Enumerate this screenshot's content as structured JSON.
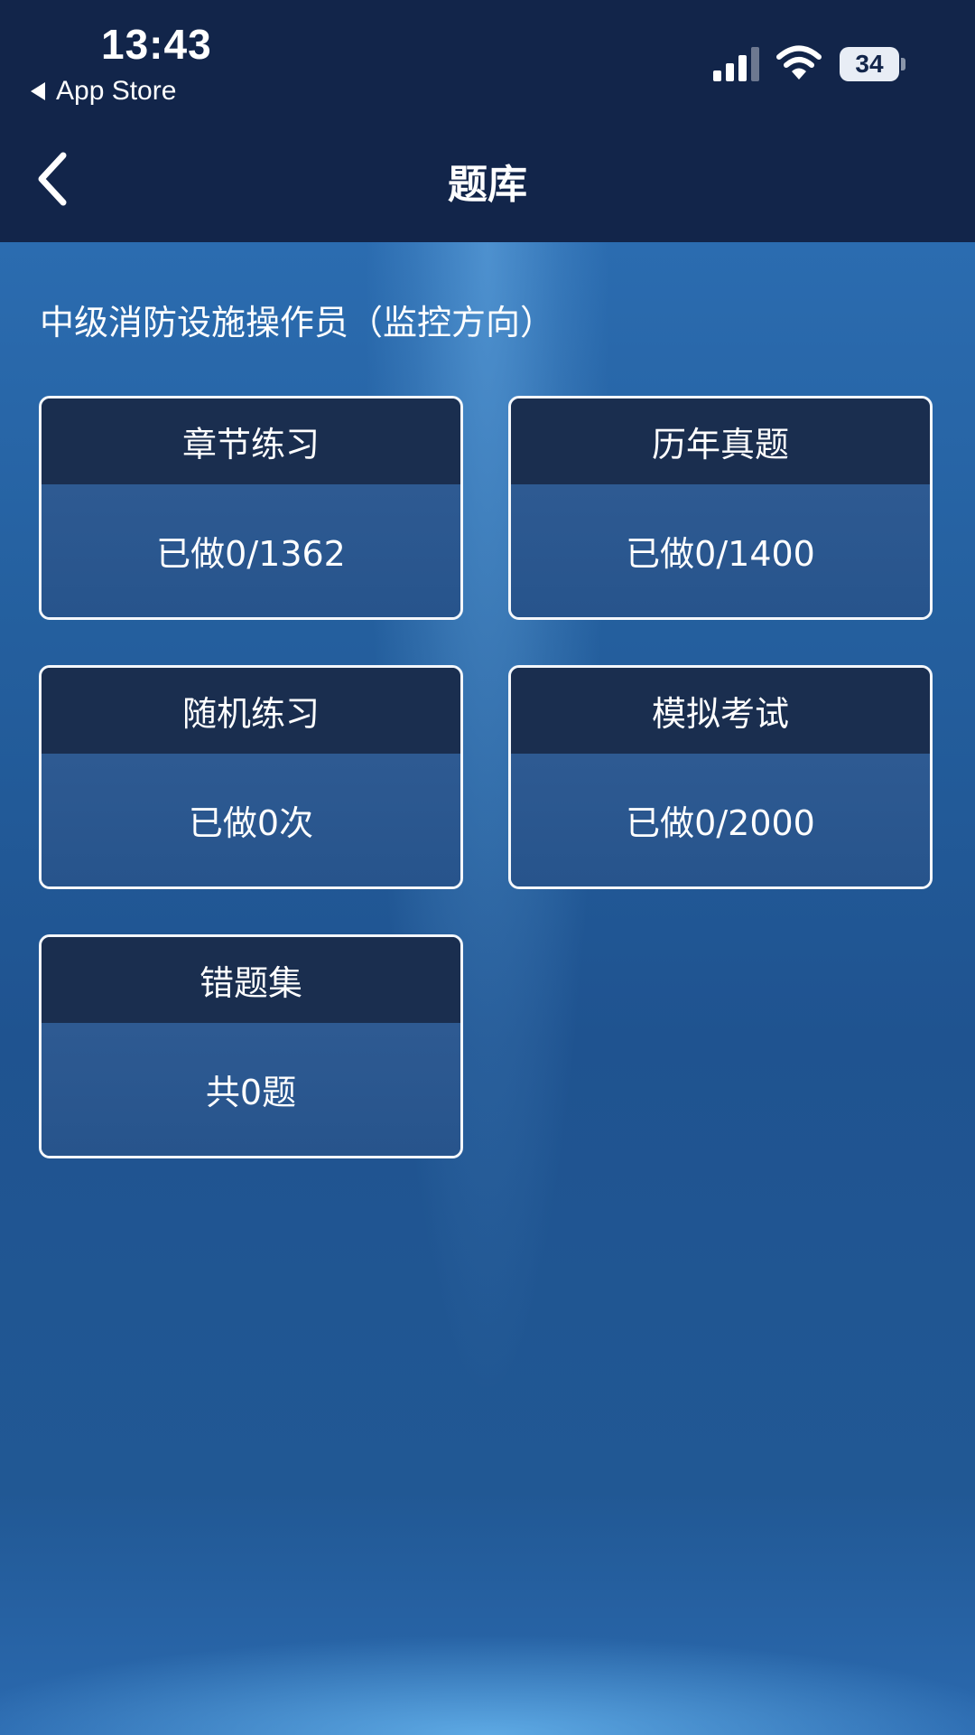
{
  "status_bar": {
    "time": "13:43",
    "back_app": "App Store",
    "battery_level": "34",
    "signal_icon": "signal-bars-icon",
    "wifi_icon": "wifi-icon"
  },
  "header": {
    "title": "题库",
    "back_icon": "chevron-left-icon"
  },
  "subject": {
    "title": "中级消防设施操作员（监控方向）"
  },
  "cards": [
    {
      "title": "章节练习",
      "status": "已做0/1362"
    },
    {
      "title": "历年真题",
      "status": "已做0/1400"
    },
    {
      "title": "随机练习",
      "status": "已做0次"
    },
    {
      "title": "模拟考试",
      "status": "已做0/2000"
    },
    {
      "title": "错题集",
      "status": "共0题"
    }
  ],
  "colors": {
    "header_bg": "#12254a",
    "card_head_bg": "#1a2e4f",
    "card_body_bg": "#2e5a92",
    "page_bg": "#2b6cb0",
    "card_border": "#f4f7fb"
  }
}
